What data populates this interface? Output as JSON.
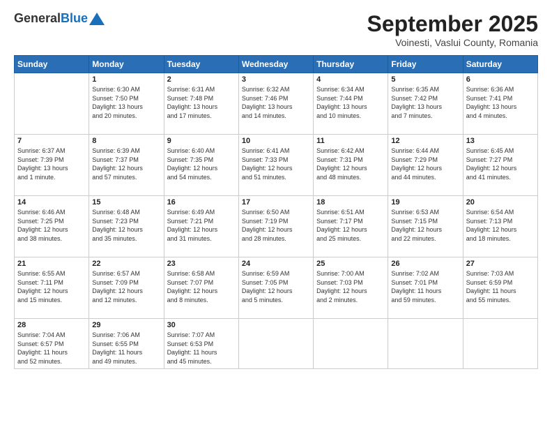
{
  "header": {
    "logo_general": "General",
    "logo_blue": "Blue",
    "main_title": "September 2025",
    "subtitle": "Voinesti, Vaslui County, Romania"
  },
  "days": [
    "Sunday",
    "Monday",
    "Tuesday",
    "Wednesday",
    "Thursday",
    "Friday",
    "Saturday"
  ],
  "weeks": [
    [
      {
        "date": "",
        "info": ""
      },
      {
        "date": "1",
        "info": "Sunrise: 6:30 AM\nSunset: 7:50 PM\nDaylight: 13 hours\nand 20 minutes."
      },
      {
        "date": "2",
        "info": "Sunrise: 6:31 AM\nSunset: 7:48 PM\nDaylight: 13 hours\nand 17 minutes."
      },
      {
        "date": "3",
        "info": "Sunrise: 6:32 AM\nSunset: 7:46 PM\nDaylight: 13 hours\nand 14 minutes."
      },
      {
        "date": "4",
        "info": "Sunrise: 6:34 AM\nSunset: 7:44 PM\nDaylight: 13 hours\nand 10 minutes."
      },
      {
        "date": "5",
        "info": "Sunrise: 6:35 AM\nSunset: 7:42 PM\nDaylight: 13 hours\nand 7 minutes."
      },
      {
        "date": "6",
        "info": "Sunrise: 6:36 AM\nSunset: 7:41 PM\nDaylight: 13 hours\nand 4 minutes."
      }
    ],
    [
      {
        "date": "7",
        "info": "Sunrise: 6:37 AM\nSunset: 7:39 PM\nDaylight: 13 hours\nand 1 minute."
      },
      {
        "date": "8",
        "info": "Sunrise: 6:39 AM\nSunset: 7:37 PM\nDaylight: 12 hours\nand 57 minutes."
      },
      {
        "date": "9",
        "info": "Sunrise: 6:40 AM\nSunset: 7:35 PM\nDaylight: 12 hours\nand 54 minutes."
      },
      {
        "date": "10",
        "info": "Sunrise: 6:41 AM\nSunset: 7:33 PM\nDaylight: 12 hours\nand 51 minutes."
      },
      {
        "date": "11",
        "info": "Sunrise: 6:42 AM\nSunset: 7:31 PM\nDaylight: 12 hours\nand 48 minutes."
      },
      {
        "date": "12",
        "info": "Sunrise: 6:44 AM\nSunset: 7:29 PM\nDaylight: 12 hours\nand 44 minutes."
      },
      {
        "date": "13",
        "info": "Sunrise: 6:45 AM\nSunset: 7:27 PM\nDaylight: 12 hours\nand 41 minutes."
      }
    ],
    [
      {
        "date": "14",
        "info": "Sunrise: 6:46 AM\nSunset: 7:25 PM\nDaylight: 12 hours\nand 38 minutes."
      },
      {
        "date": "15",
        "info": "Sunrise: 6:48 AM\nSunset: 7:23 PM\nDaylight: 12 hours\nand 35 minutes."
      },
      {
        "date": "16",
        "info": "Sunrise: 6:49 AM\nSunset: 7:21 PM\nDaylight: 12 hours\nand 31 minutes."
      },
      {
        "date": "17",
        "info": "Sunrise: 6:50 AM\nSunset: 7:19 PM\nDaylight: 12 hours\nand 28 minutes."
      },
      {
        "date": "18",
        "info": "Sunrise: 6:51 AM\nSunset: 7:17 PM\nDaylight: 12 hours\nand 25 minutes."
      },
      {
        "date": "19",
        "info": "Sunrise: 6:53 AM\nSunset: 7:15 PM\nDaylight: 12 hours\nand 22 minutes."
      },
      {
        "date": "20",
        "info": "Sunrise: 6:54 AM\nSunset: 7:13 PM\nDaylight: 12 hours\nand 18 minutes."
      }
    ],
    [
      {
        "date": "21",
        "info": "Sunrise: 6:55 AM\nSunset: 7:11 PM\nDaylight: 12 hours\nand 15 minutes."
      },
      {
        "date": "22",
        "info": "Sunrise: 6:57 AM\nSunset: 7:09 PM\nDaylight: 12 hours\nand 12 minutes."
      },
      {
        "date": "23",
        "info": "Sunrise: 6:58 AM\nSunset: 7:07 PM\nDaylight: 12 hours\nand 8 minutes."
      },
      {
        "date": "24",
        "info": "Sunrise: 6:59 AM\nSunset: 7:05 PM\nDaylight: 12 hours\nand 5 minutes."
      },
      {
        "date": "25",
        "info": "Sunrise: 7:00 AM\nSunset: 7:03 PM\nDaylight: 12 hours\nand 2 minutes."
      },
      {
        "date": "26",
        "info": "Sunrise: 7:02 AM\nSunset: 7:01 PM\nDaylight: 11 hours\nand 59 minutes."
      },
      {
        "date": "27",
        "info": "Sunrise: 7:03 AM\nSunset: 6:59 PM\nDaylight: 11 hours\nand 55 minutes."
      }
    ],
    [
      {
        "date": "28",
        "info": "Sunrise: 7:04 AM\nSunset: 6:57 PM\nDaylight: 11 hours\nand 52 minutes."
      },
      {
        "date": "29",
        "info": "Sunrise: 7:06 AM\nSunset: 6:55 PM\nDaylight: 11 hours\nand 49 minutes."
      },
      {
        "date": "30",
        "info": "Sunrise: 7:07 AM\nSunset: 6:53 PM\nDaylight: 11 hours\nand 45 minutes."
      },
      {
        "date": "",
        "info": ""
      },
      {
        "date": "",
        "info": ""
      },
      {
        "date": "",
        "info": ""
      },
      {
        "date": "",
        "info": ""
      }
    ]
  ]
}
